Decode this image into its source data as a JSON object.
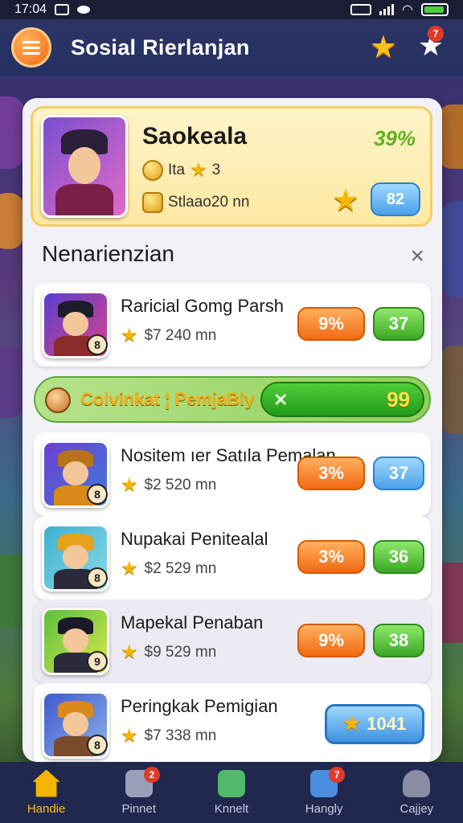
{
  "status_bar": {
    "time": "17:04"
  },
  "header": {
    "title": "Sosial Rierlanjan",
    "notification_count": "7"
  },
  "profile": {
    "name": "Saokeala",
    "percent": "39%",
    "line1_label": "Ita",
    "line1_value": "3",
    "line2_text": "Stlaao20 nn",
    "pill_value": "82"
  },
  "section": {
    "title": "Nenarienzian",
    "close_label": "×"
  },
  "rows": [
    {
      "name": "Raricial Gomg Parsh",
      "sub": "$7 240 mn",
      "level": "8",
      "pill1": "9%",
      "pill2": "37",
      "pill2_color": "green"
    },
    {
      "name": "Nositem ıer Satıla Pemalan",
      "sub": "$2 520 mn",
      "level": "8",
      "pill1": "3%",
      "pill2": "37",
      "pill2_color": "blue"
    },
    {
      "name": "Nupakai Penitealal",
      "sub": "$2 529 mn",
      "level": "8",
      "pill1": "3%",
      "pill2": "36",
      "pill2_color": "green"
    },
    {
      "name": "Mapekal Penaban",
      "sub": "$9 529 mn",
      "level": "9",
      "pill1": "9%",
      "pill2": "38",
      "pill2_color": "green"
    },
    {
      "name": "Peringkak Pemigian",
      "sub": "$7 338 mn",
      "level": "8",
      "big_pill": "1041"
    }
  ],
  "promo": {
    "text": "Colvinkat ¦ PemjaBly",
    "value": "99"
  },
  "nav": [
    {
      "label": "Handie",
      "badge": "",
      "color": "#f4b400"
    },
    {
      "label": "Pinnet",
      "badge": "2",
      "color": "#9aa0b8"
    },
    {
      "label": "Knnelt",
      "badge": "",
      "color": "#52b86a"
    },
    {
      "label": "Hangly",
      "badge": "7",
      "color": "#4a8ee0"
    },
    {
      "label": "Cajjey",
      "badge": "",
      "color": "#8a8ea5"
    }
  ],
  "colors": {
    "accent_orange": "#f26a12",
    "accent_green": "#3ca825",
    "accent_blue": "#4aa2ea",
    "header_bg": "#253061"
  }
}
